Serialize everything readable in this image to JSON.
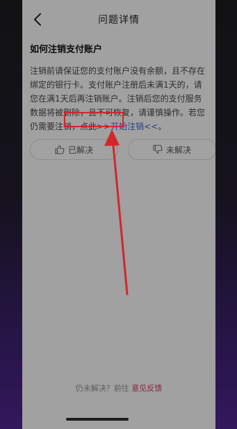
{
  "header": {
    "title": "问题详情",
    "back_icon": "chevron-left-icon"
  },
  "question": {
    "title": "如何注销支付账户"
  },
  "answer": {
    "text_before": "注销前请保证您的支付账户没有余额，且不存在绑定的银行卡。支付账户注册后未满1天的，请您在满1天后再注销账户。注销后您的支付服务数据将被删除，且不可恢复，请谨慎操作。若您仍需要注销，点此",
    "link_text": ">>开始注销<<",
    "text_after": "。"
  },
  "feedback_buttons": {
    "solved_label": "已解决",
    "unsolved_label": "未解决",
    "solved_icon": "thumbs-up-icon",
    "unsolved_icon": "thumbs-down-icon"
  },
  "footer": {
    "prefix": "仍未解决？前往",
    "link": "意见反馈"
  },
  "colors": {
    "link": "#3a63c8",
    "annotation_red": "#d3262a",
    "feedback_link": "#c23a5a"
  }
}
